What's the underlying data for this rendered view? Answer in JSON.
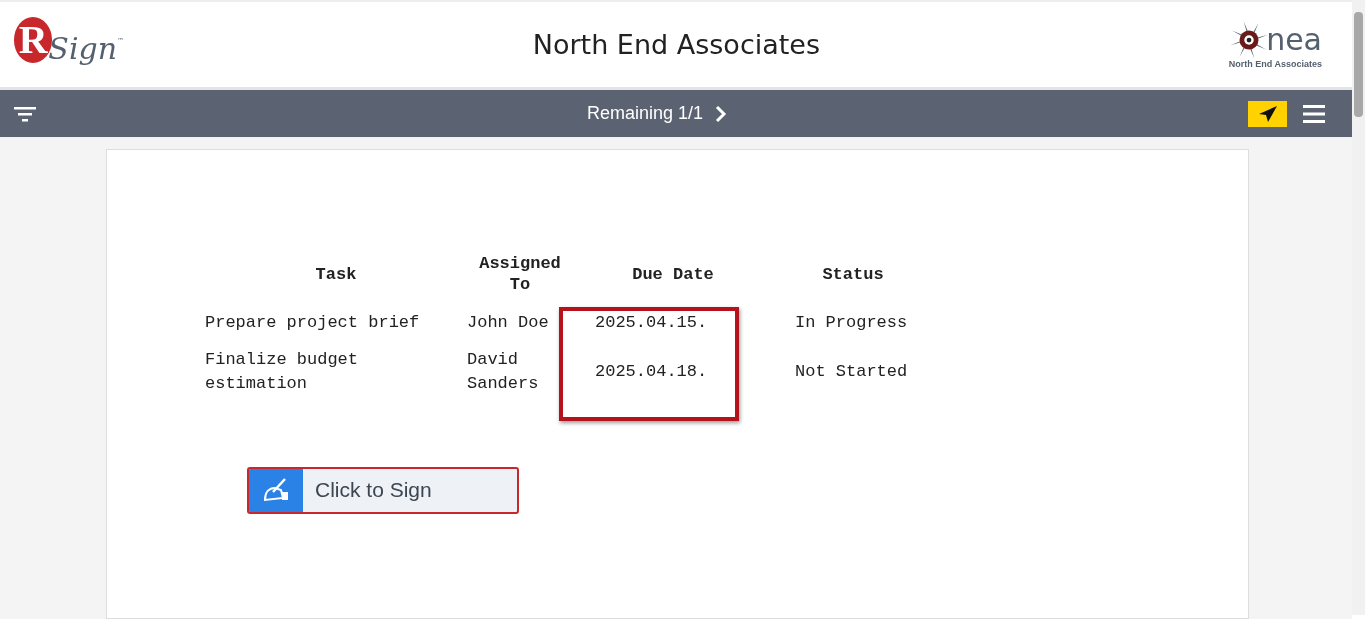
{
  "header": {
    "logo_left": {
      "letter": "R",
      "word": "Sign",
      "mark": "™"
    },
    "title": "North End Associates",
    "logo_right": {
      "word": "nea",
      "caption": "North End Associates"
    }
  },
  "toolbar": {
    "remaining": "Remaining 1/1"
  },
  "table": {
    "columns": [
      {
        "label": "Task",
        "highlighted": false
      },
      {
        "label": "Assigned To",
        "highlighted": false
      },
      {
        "label": "Due Date",
        "highlighted": true
      },
      {
        "label": "Status",
        "highlighted": false
      }
    ],
    "rows": [
      [
        "Prepare project brief",
        "John Doe",
        "2025.04.15.",
        "In Progress"
      ],
      [
        "Finalize budget estimation",
        "David Sanders",
        "2025.04.18.",
        "Not Started"
      ]
    ]
  },
  "sign_button": {
    "label": "Click to Sign"
  }
}
